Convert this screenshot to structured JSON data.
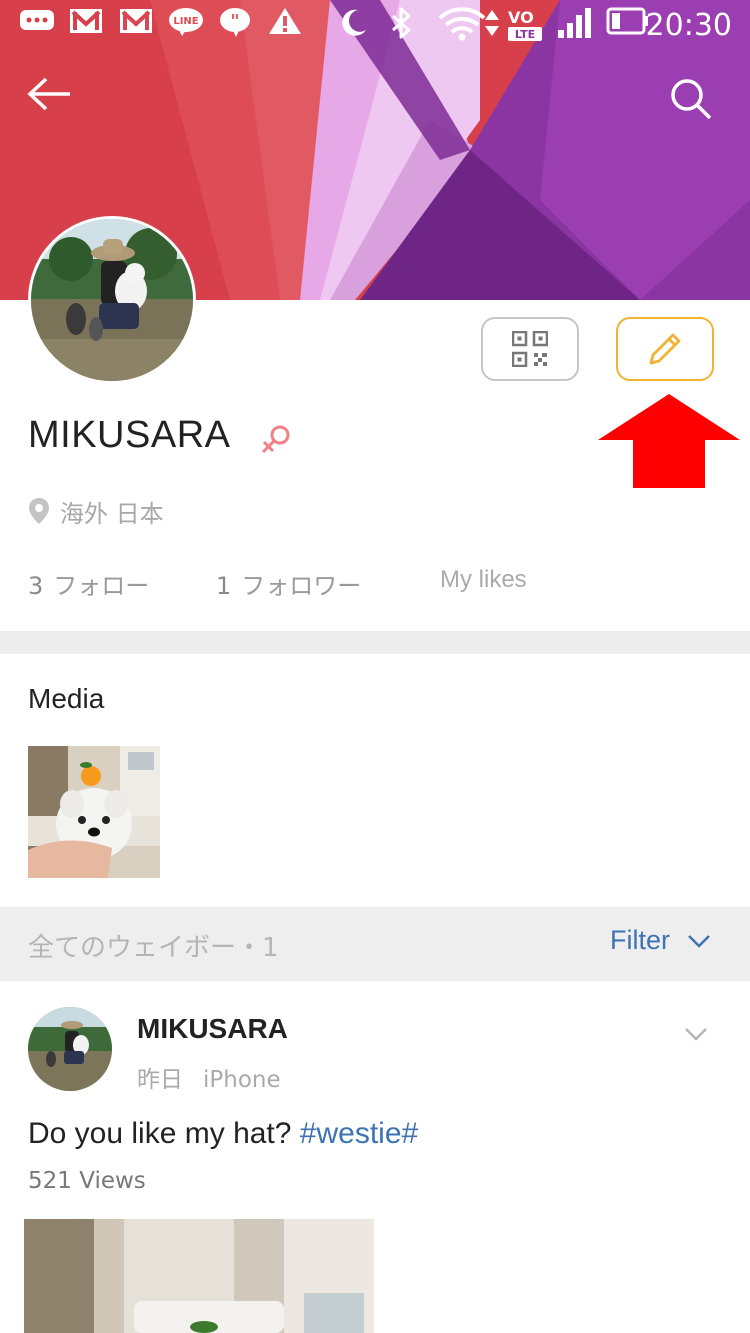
{
  "status_bar": {
    "time": "20:30",
    "icons": [
      "chat-bubble-icon",
      "gmail-icon",
      "gmail-icon",
      "line-icon",
      "quote-bubble-icon",
      "warning-icon",
      "moon-icon",
      "bluetooth-icon",
      "wifi-icon",
      "volte-icon",
      "signal-icon",
      "battery-icon"
    ],
    "line_label": "LINE",
    "volte_label_top": "VO",
    "volte_label_bottom": "LTE"
  },
  "header": {
    "back_icon": "back-arrow-icon",
    "search_icon": "search-icon",
    "banner_colors": [
      "#d8404a",
      "#e0505a",
      "#e7a6e8",
      "#7a2a8e",
      "#9a3db0"
    ]
  },
  "profile": {
    "name": "MIKUSARA",
    "gender_icon": "female-symbol-icon",
    "gender_color": "#f07f86",
    "location": "海外 日本",
    "qr_icon": "qr-code-icon",
    "edit_icon": "pencil-icon",
    "edit_accent": "#f2b233",
    "stats": [
      {
        "num": "3",
        "label": "フォロー"
      },
      {
        "num": "1",
        "label": "フォロワー"
      },
      {
        "num": "",
        "label": "My likes"
      }
    ]
  },
  "annotation": {
    "arrow_color": "#ff0000",
    "arrow_icon": "red-up-arrow-icon"
  },
  "media": {
    "title": "Media"
  },
  "feed": {
    "posts_count_label": "全てのウェイボー・1",
    "filter_label": "Filter",
    "filter_color": "#3d73b3"
  },
  "post": {
    "author": "MIKUSARA",
    "time": "昨日",
    "device": "iPhone",
    "text": "Do you like my hat? ",
    "hashtag": "#westie#",
    "views": "521 Views"
  }
}
